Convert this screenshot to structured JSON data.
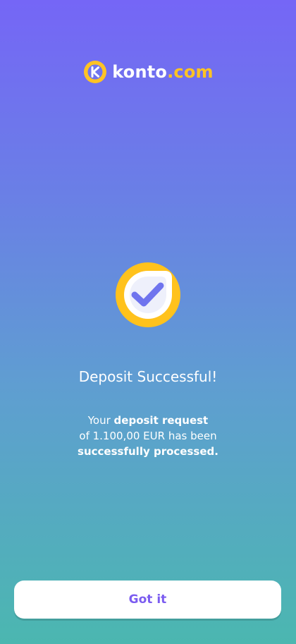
{
  "brand": {
    "logo_icon": "konto-k-logo-icon",
    "name_part": "konto",
    "dot": ".",
    "tld": "com",
    "accent_color": "#ffc324"
  },
  "status": {
    "icon": "success-check-icon",
    "title": "Deposit Successful!"
  },
  "message": {
    "line1_prefix": "Your ",
    "line1_bold": "deposit request",
    "line2": "of 1.100,00 EUR has been",
    "line3_bold": "successfully processed."
  },
  "actions": {
    "primary_label": "Got it"
  },
  "colors": {
    "gradient_top": "#7566f6",
    "gradient_bottom": "#4bb7b0",
    "button_text": "#7b5cf0"
  }
}
